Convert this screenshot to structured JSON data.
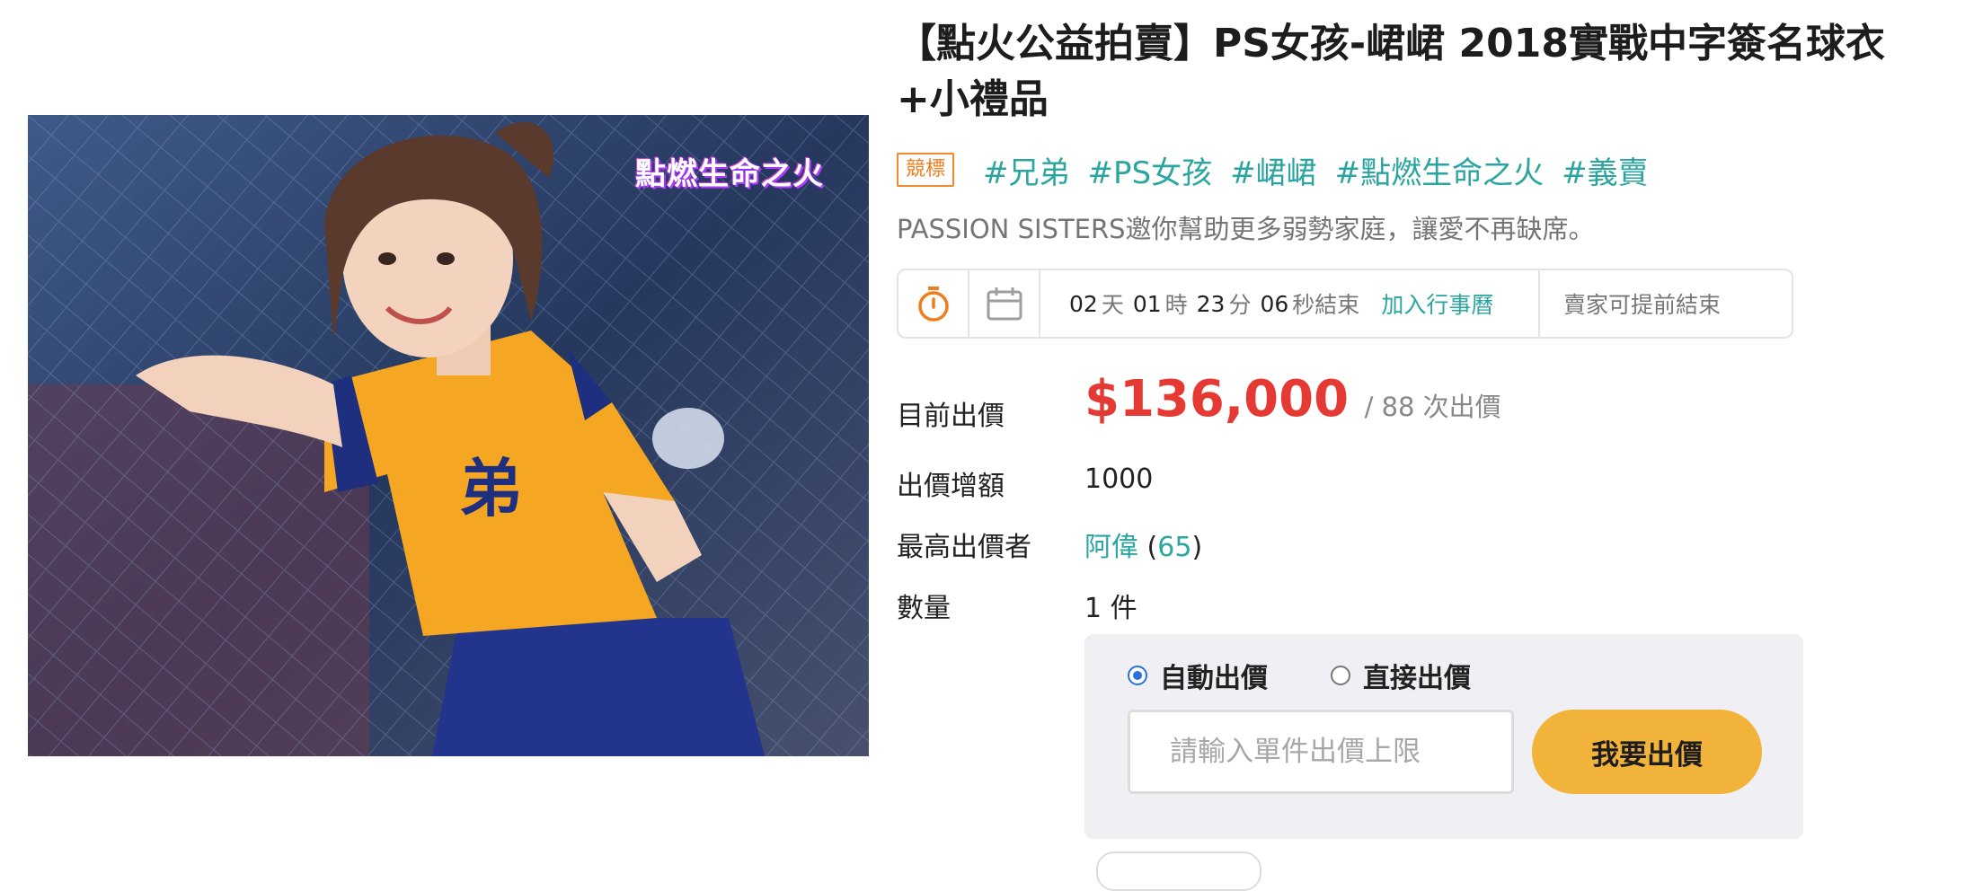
{
  "product": {
    "title": "【點火公益拍賣】PS女孩-峮峮 2018實戰中字簽名球衣+小禮品",
    "photo_logo": "點燃生命之火",
    "badge": "競標",
    "tags": [
      "#兄弟",
      "#PS女孩",
      "#峮峮",
      "#點燃生命之火",
      "#義賣"
    ],
    "subtitle": "PASSION SISTERS邀你幫助更多弱勢家庭，讓愛不再缺席。"
  },
  "countdown": {
    "days": "02",
    "days_unit": "天",
    "hours": "01",
    "hours_unit": "時",
    "minutes": "23",
    "minutes_unit": "分",
    "seconds": "06",
    "seconds_unit": "秒結束",
    "add_calendar": "加入行事曆",
    "seller_note": "賣家可提前結束"
  },
  "info": {
    "current_bid_label": "目前出價",
    "current_bid": "$136,000",
    "bid_count_text": "/ 88 次出價",
    "increment_label": "出價增額",
    "increment": "1000",
    "top_bidder_label": "最高出價者",
    "top_bidder": "阿偉",
    "top_bidder_open": " (",
    "top_bidder_score": "65",
    "top_bidder_close": ")",
    "quantity_label": "數量",
    "quantity": "1 件"
  },
  "bid_panel": {
    "auto_bid_label": "自動出價",
    "direct_bid_label": "直接出價",
    "selected": "auto",
    "input_placeholder": "請輸入單件出價上限",
    "submit_label": "我要出價"
  },
  "colors": {
    "accent": "#2aa5a0",
    "price": "#e53a34",
    "button": "#f2b33a",
    "badge": "#ef7d1b",
    "radio": "#2b6fe6"
  },
  "icons": [
    "stopwatch-icon",
    "calendar-icon"
  ]
}
